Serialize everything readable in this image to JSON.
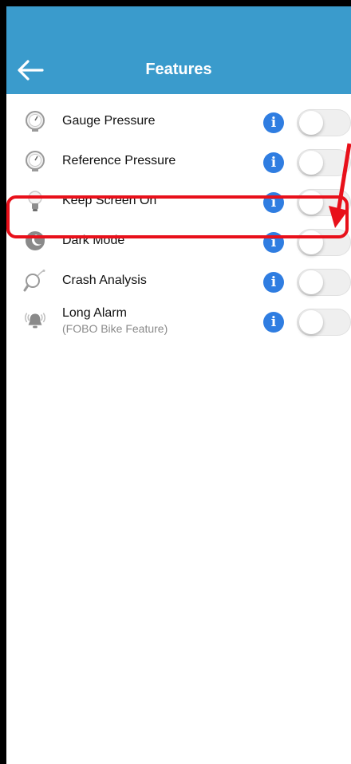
{
  "header": {
    "title": "Features",
    "back_icon": "arrow-left-icon",
    "color": "#3a9bcc"
  },
  "features": [
    {
      "label": "Gauge Pressure",
      "sub": "",
      "icon": "gauge-icon",
      "enabled": false
    },
    {
      "label": "Reference Pressure",
      "sub": "",
      "icon": "gauge-icon",
      "enabled": false
    },
    {
      "label": "Keep Screen On",
      "sub": "",
      "icon": "lightbulb-icon",
      "enabled": false
    },
    {
      "label": "Dark Mode",
      "sub": "",
      "icon": "moon-icon",
      "enabled": false
    },
    {
      "label": "Crash Analysis",
      "sub": "",
      "icon": "magnifier-icon",
      "enabled": false
    },
    {
      "label": "Long Alarm",
      "sub": "(FOBO Bike Feature)",
      "icon": "bell-alarm-icon",
      "enabled": false
    }
  ],
  "info_glyph": "i",
  "annotation": {
    "highlight_color": "#e8101a",
    "highlighted_item": "Dark Mode"
  }
}
